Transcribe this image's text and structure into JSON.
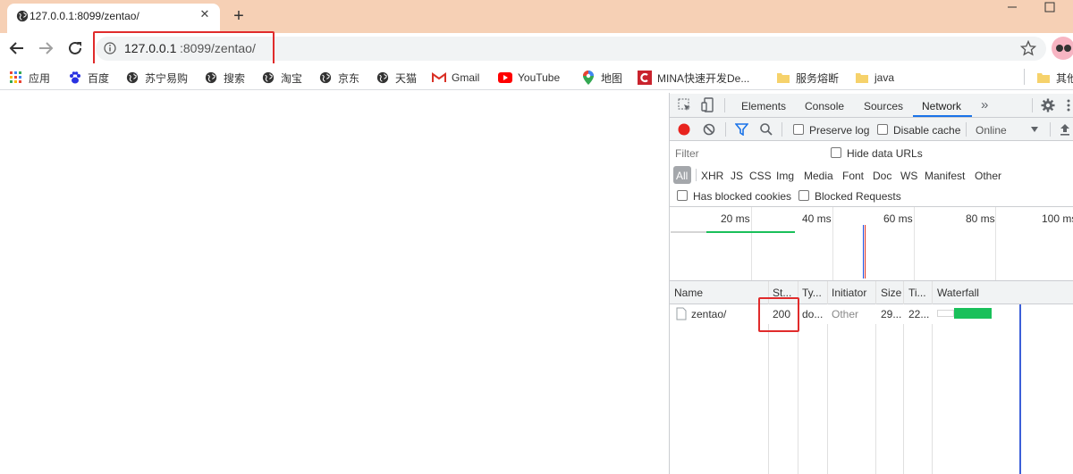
{
  "browser": {
    "tab": {
      "title": "127.0.0.1:8099/zentao/",
      "close": "✕"
    },
    "new_tab": "+",
    "url": {
      "host": "127.0.0.1",
      "rest": ":8099/zentao/"
    }
  },
  "bookmarks": [
    {
      "label": "应用",
      "icon": "apps-grid-icon"
    },
    {
      "label": "百度",
      "icon": "baidu-paw-icon"
    },
    {
      "label": "苏宁易购",
      "icon": "globe-icon"
    },
    {
      "label": "搜索",
      "icon": "globe-icon"
    },
    {
      "label": "淘宝",
      "icon": "globe-icon"
    },
    {
      "label": "京东",
      "icon": "globe-icon"
    },
    {
      "label": "天猫",
      "icon": "globe-icon"
    },
    {
      "label": "Gmail",
      "icon": "gmail-icon"
    },
    {
      "label": "YouTube",
      "icon": "youtube-icon"
    },
    {
      "label": "地图",
      "icon": "maps-pin-icon"
    },
    {
      "label": "MINA快速开发De...",
      "icon": "csdn-icon"
    },
    {
      "label": "服务熔断",
      "icon": "folder-icon"
    },
    {
      "label": "java",
      "icon": "folder-icon"
    },
    {
      "label": "其他",
      "icon": "folder-icon"
    }
  ],
  "devtools": {
    "tabs": [
      "Elements",
      "Console",
      "Sources",
      "Network"
    ],
    "active_tab": "Network",
    "more": "»",
    "toolbar": {
      "preserve_log": "Preserve log",
      "disable_cache": "Disable cache",
      "throttling": "Online"
    },
    "filter": {
      "placeholder": "Filter",
      "hide_data_urls": "Hide data URLs",
      "types": [
        "All",
        "XHR",
        "JS",
        "CSS",
        "Img",
        "Media",
        "Font",
        "Doc",
        "WS",
        "Manifest",
        "Other"
      ],
      "has_blocked_cookies": "Has blocked cookies",
      "blocked_requests": "Blocked Requests"
    },
    "overview": {
      "ticks": [
        "20 ms",
        "40 ms",
        "60 ms",
        "80 ms",
        "100 ms"
      ]
    },
    "table": {
      "columns": [
        "Name",
        "St...",
        "Ty...",
        "Initiator",
        "Size",
        "Ti...",
        "Waterfall"
      ],
      "rows": [
        {
          "name": "zentao/",
          "status": "200",
          "type": "do...",
          "initiator": "Other",
          "size": "29...",
          "time": "22..."
        }
      ]
    }
  },
  "colors": {
    "tabstrip": "#f6d0b5",
    "highlight": "#e02b2b",
    "accent": "#1a73e8",
    "waterfall_bar": "#19c05a",
    "record": "#e8231e"
  }
}
